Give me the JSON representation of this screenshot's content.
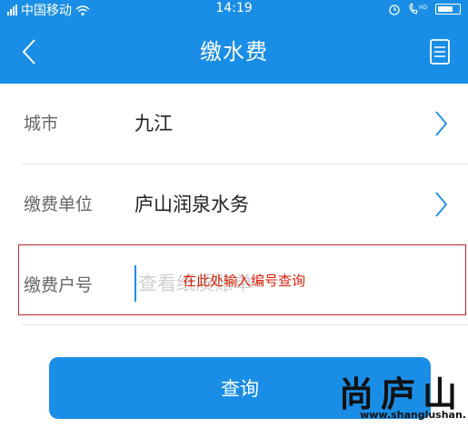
{
  "status_bar": {
    "carrier": "中国移动",
    "time": "14:19"
  },
  "nav": {
    "title": "缴水费"
  },
  "form": {
    "city": {
      "label": "城市",
      "value": "九江"
    },
    "unit": {
      "label": "缴费单位",
      "value": "庐山润泉水务"
    },
    "account": {
      "label": "缴费户号",
      "placeholder": "查看纸质账单",
      "value": ""
    }
  },
  "annotation": "在此处输入编号查询",
  "query_button": {
    "label": "查询"
  },
  "watermark": {
    "logo": "尚庐山",
    "url": "www.shanglushan."
  },
  "colors": {
    "accent": "#1a8ee6",
    "annotation": "#d81e06",
    "highlight_border": "#c4242a"
  }
}
